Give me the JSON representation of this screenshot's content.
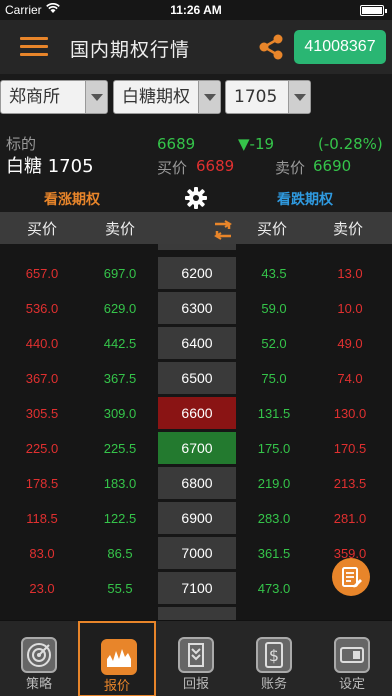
{
  "status": {
    "carrier": "Carrier",
    "time": "11:26 AM"
  },
  "nav": {
    "title": "国内期权行情",
    "account": "41008367"
  },
  "selectors": [
    {
      "value": "郑商所"
    },
    {
      "value": "白糖期权"
    },
    {
      "value": "1705"
    }
  ],
  "quote": {
    "label": "标的",
    "name": "白糖 1705",
    "price": "6689",
    "change": "▼-19",
    "change_pct": "(-0.28%)",
    "bid_label": "买价",
    "bid": "6689",
    "ask_label": "卖价",
    "ask": "6690"
  },
  "sections": {
    "call": "看涨期权",
    "put": "看跌期权"
  },
  "columns": {
    "call_bid": "买价",
    "call_ask": "卖价",
    "put_bid": "买价",
    "put_ask": "卖价"
  },
  "rows": [
    {
      "call_bid": "657.0",
      "call_ask": "697.0",
      "strike": "6200",
      "put_bid": "43.5",
      "put_ask": "13.0",
      "highlight": ""
    },
    {
      "call_bid": "536.0",
      "call_ask": "629.0",
      "strike": "6300",
      "put_bid": "59.0",
      "put_ask": "10.0",
      "highlight": ""
    },
    {
      "call_bid": "440.0",
      "call_ask": "442.5",
      "strike": "6400",
      "put_bid": "52.0",
      "put_ask": "49.0",
      "highlight": ""
    },
    {
      "call_bid": "367.0",
      "call_ask": "367.5",
      "strike": "6500",
      "put_bid": "75.0",
      "put_ask": "74.0",
      "highlight": ""
    },
    {
      "call_bid": "305.5",
      "call_ask": "309.0",
      "strike": "6600",
      "put_bid": "131.5",
      "put_ask": "130.0",
      "highlight": "red"
    },
    {
      "call_bid": "225.0",
      "call_ask": "225.5",
      "strike": "6700",
      "put_bid": "175.0",
      "put_ask": "170.5",
      "highlight": "green"
    },
    {
      "call_bid": "178.5",
      "call_ask": "183.0",
      "strike": "6800",
      "put_bid": "219.0",
      "put_ask": "213.5",
      "highlight": ""
    },
    {
      "call_bid": "118.5",
      "call_ask": "122.5",
      "strike": "6900",
      "put_bid": "283.0",
      "put_ask": "281.0",
      "highlight": ""
    },
    {
      "call_bid": "83.0",
      "call_ask": "86.5",
      "strike": "7000",
      "put_bid": "361.5",
      "put_ask": "359.0",
      "highlight": ""
    },
    {
      "call_bid": "23.0",
      "call_ask": "55.5",
      "strike": "7100",
      "put_bid": "473.0",
      "put_ask": "",
      "highlight": ""
    }
  ],
  "tabs": [
    {
      "label": "策略",
      "icon": "target-icon"
    },
    {
      "label": "报价",
      "icon": "chart-icon",
      "active": true
    },
    {
      "label": "回报",
      "icon": "report-icon"
    },
    {
      "label": "账务",
      "icon": "dollar-icon"
    },
    {
      "label": "设定",
      "icon": "settings-icon"
    }
  ],
  "colors": {
    "accent": "#e8852a",
    "up": "#e03030",
    "down": "#35c44a",
    "put": "#2f9ae0",
    "account_bg": "#2ab673"
  }
}
